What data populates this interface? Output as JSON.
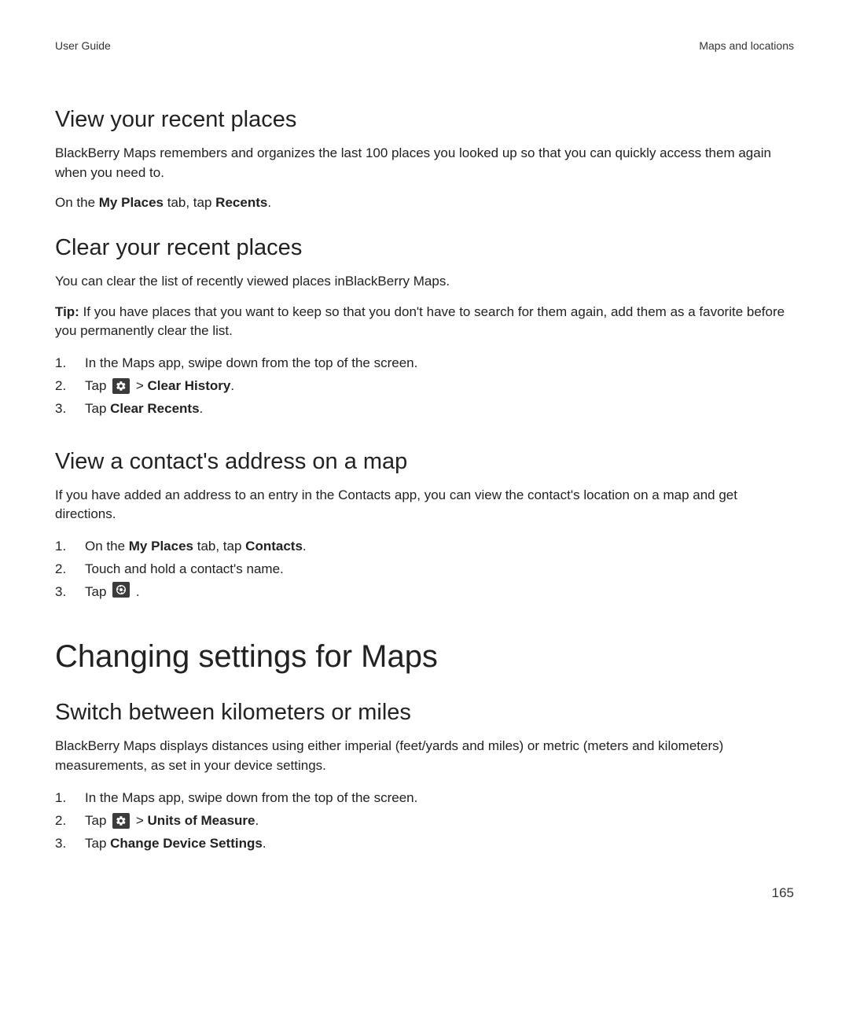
{
  "header": {
    "left": "User Guide",
    "right": "Maps and locations"
  },
  "sec1": {
    "title": "View your recent places",
    "p1": "BlackBerry Maps remembers and organizes the last 100 places you looked up so that you can quickly access them again when you need to.",
    "p2_a": "On the ",
    "p2_b": "My Places",
    "p2_c": " tab, tap ",
    "p2_d": "Recents",
    "p2_e": "."
  },
  "sec2": {
    "title": "Clear your recent places",
    "p1": "You can clear the list of recently viewed places inBlackBerry Maps.",
    "tip_label": "Tip:",
    "tip_text": " If you have places that you want to keep so that you don't have to search for them again, add them as a favorite before you permanently clear the list.",
    "steps": {
      "s1": "In the Maps app, swipe down from the top of the screen.",
      "s2_pre": "Tap ",
      "s2_sep": " > ",
      "s2_bold": "Clear History",
      "s2_end": ".",
      "s3_pre": "Tap ",
      "s3_bold": "Clear Recents",
      "s3_end": "."
    }
  },
  "sec3": {
    "title": "View a contact's address on a map",
    "p1": "If you have added an address to an entry in the Contacts app, you can view the contact's location on a map and get directions.",
    "steps": {
      "s1_a": "On the ",
      "s1_b": "My Places",
      "s1_c": " tab, tap ",
      "s1_d": "Contacts",
      "s1_e": ".",
      "s2": "Touch and hold a contact's name.",
      "s3_pre": "Tap ",
      "s3_end": " ."
    }
  },
  "major": {
    "title": "Changing settings for Maps"
  },
  "sec4": {
    "title": "Switch between kilometers or miles",
    "p1": "BlackBerry Maps displays distances using either imperial (feet/yards and miles) or metric (meters and kilometers) measurements, as set in your device settings.",
    "steps": {
      "s1": "In the Maps app, swipe down from the top of the screen.",
      "s2_pre": "Tap ",
      "s2_sep": " > ",
      "s2_bold": "Units of Measure",
      "s2_end": ".",
      "s3_pre": "Tap ",
      "s3_bold": "Change Device Settings",
      "s3_end": "."
    }
  },
  "page_number": "165"
}
